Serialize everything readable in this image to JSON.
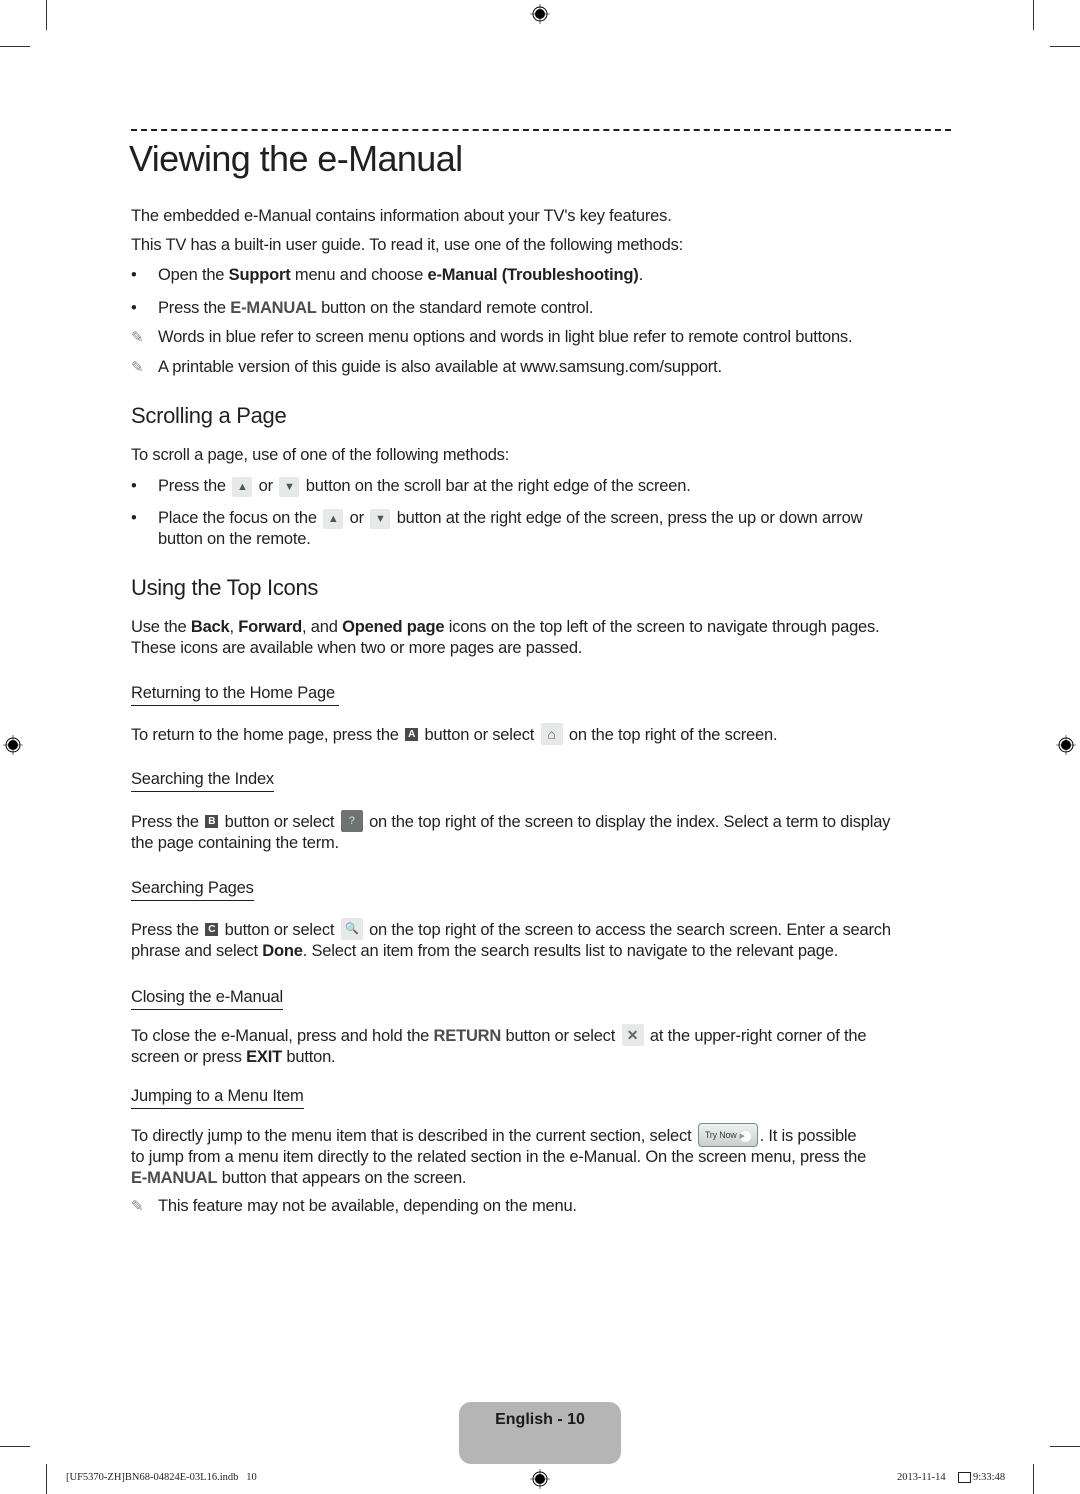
{
  "title": "Viewing the e-Manual",
  "intro": {
    "line1": "The embedded e-Manual contains information about your TV's key features.",
    "line2": "This TV has a built-in user guide. To read it, use one of the following methods:",
    "bullet1": {
      "pre": "Open the ",
      "b1": "Support",
      "mid": " menu and choose ",
      "b2": "e-Manual (Troubleshooting)",
      "post": "."
    },
    "bullet2": {
      "pre": "Press the ",
      "key": "E-MANUAL",
      "post": " button on the standard remote control."
    },
    "note1": "Words in blue refer to screen menu options and words in light blue refer to remote control buttons.",
    "note2": "A printable version of this guide is also available at www.samsung.com/support."
  },
  "scrolling": {
    "heading": "Scrolling a Page",
    "intro": "To scroll a page, use of one of the following methods:",
    "bullet1": {
      "pre": "Press the ",
      "or": " or ",
      "post": " button on the scroll bar at the right edge of the screen."
    },
    "bullet2": {
      "pre": "Place the focus on the ",
      "or": " or ",
      "post": " button at the right edge of the screen, press the up or down arrow",
      "post2": "button on the remote."
    }
  },
  "top_icons": {
    "heading": "Using the Top Icons",
    "para": {
      "pre": "Use the ",
      "b1": "Back",
      "s1": ", ",
      "b2": "Forward",
      "s2": ", and ",
      "b3": "Opened page",
      "post": " icons on the top left of the screen to navigate through pages.",
      "line2": "These icons are available when two or more pages are passed."
    },
    "home": {
      "heading": "Returning to the Home Page",
      "pre": "To return to the home page, press the ",
      "key": "A",
      "mid": " button or select ",
      "post": " on the top right of the screen."
    },
    "index": {
      "heading": "Searching the Index",
      "pre": "Press the ",
      "key": "B",
      "mid": " button or select ",
      "post": " on the top right of the screen to display the index. Select a term to display",
      "line2": "the page containing the term."
    },
    "search": {
      "heading": "Searching Pages",
      "pre": "Press the ",
      "key": "C",
      "mid": " button or select ",
      "post": " on the top right of the screen to access the search screen. Enter a search",
      "l2pre": "phrase and select ",
      "l2b": "Done",
      "l2post": ". Select an item from the search results list to navigate to the relevant page."
    },
    "close": {
      "heading": "Closing the e-Manual",
      "pre": "To close the e-Manual, press and hold the ",
      "key": "RETURN",
      "mid": " button or select ",
      "post": " at the upper-right corner of the",
      "l2pre": "screen or press ",
      "l2b": "EXIT",
      "l2post": " button."
    },
    "jump": {
      "heading": "Jumping to a Menu Item",
      "pre": "To directly jump to the menu item that is described in the current section, select ",
      "trynow": "Try Now",
      "post": ". It is possible",
      "line2": "to jump from a menu item directly to the related section in the e-Manual. On the screen menu, press the",
      "l3key": "E-MANUAL",
      "l3post": " button that appears on the screen.",
      "note": "This feature may not be available, depending on the menu."
    }
  },
  "icons": {
    "note": "✎",
    "bullet": "•",
    "up": "▲",
    "down": "▼",
    "home": "⌂",
    "index": "?",
    "search": "🔍",
    "close": "✕",
    "play": "▶"
  },
  "footer": {
    "page_label": "English - 10",
    "slug_left": "[UF5370-ZH]BN68-04824E-03L16.indb   10",
    "slug_date": "2013-11-14",
    "slug_time": "9:33:48"
  },
  "colors": {
    "text": "#231f20",
    "footer_tab": "#b5b5b5",
    "key_text": "#4d4d4d"
  }
}
